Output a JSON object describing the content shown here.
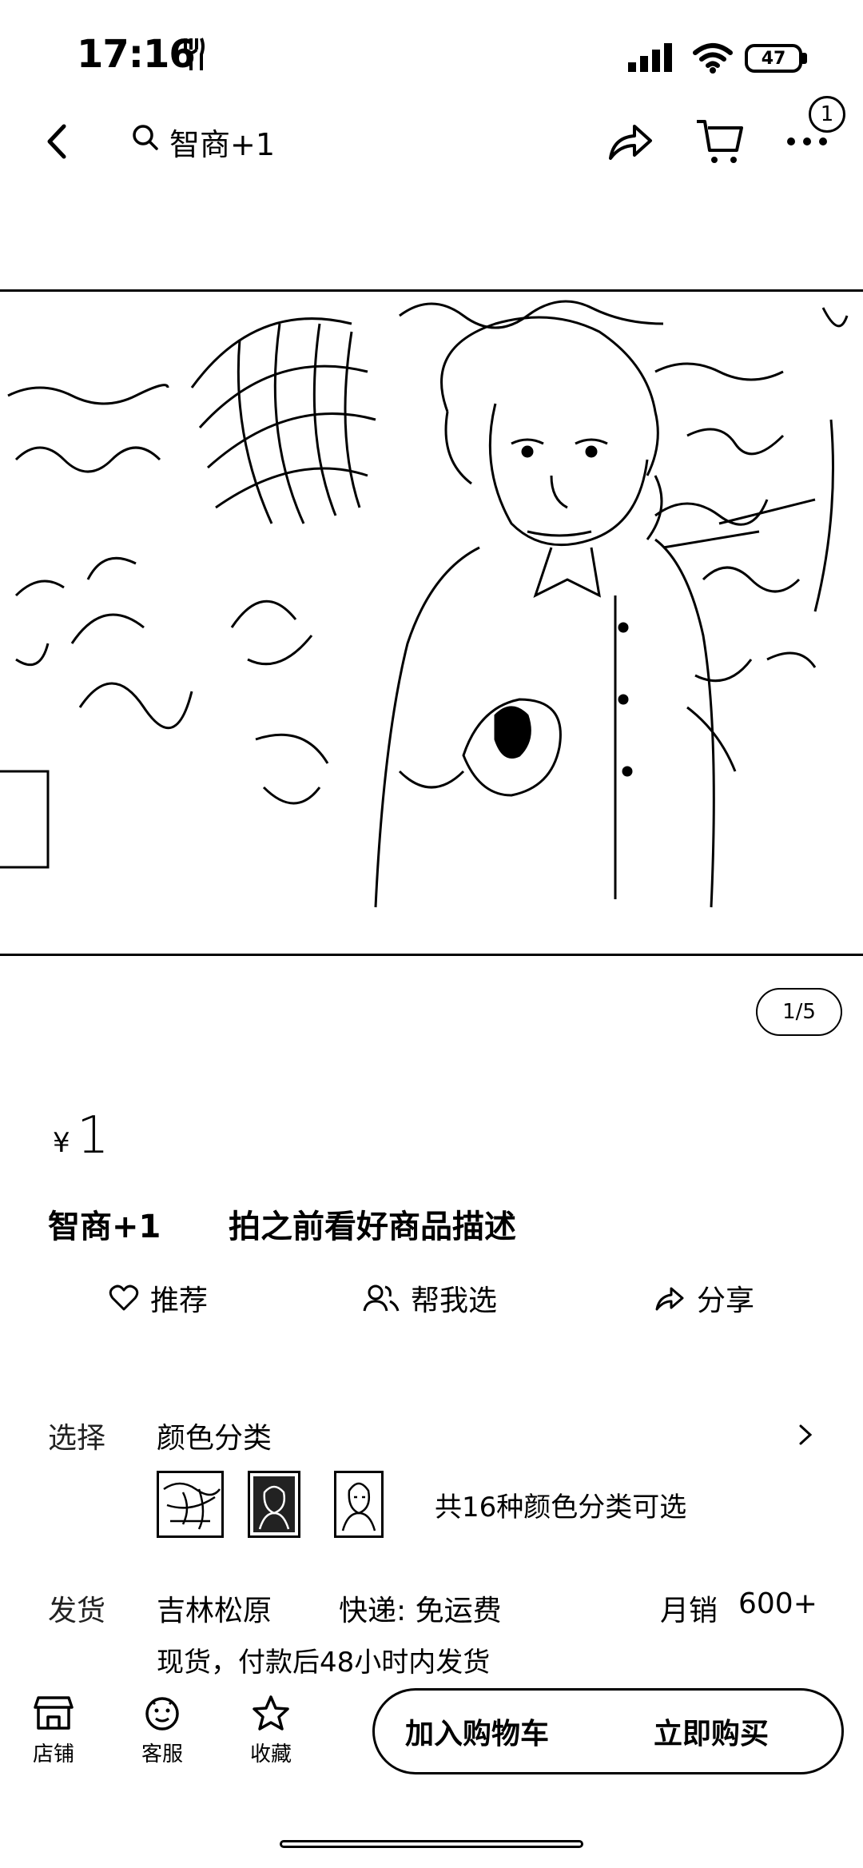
{
  "status_bar": {
    "time": "17:16",
    "battery": "47"
  },
  "nav": {
    "search_text": "智商+1",
    "cart_badge": "1"
  },
  "hero": {
    "counter": "1/5"
  },
  "product": {
    "currency": "¥",
    "price": "1",
    "title_main": "智商+1",
    "title_note": "拍之前看好商品描述"
  },
  "actions": {
    "recommend": "推荐",
    "help_choose": "帮我选",
    "share": "分享"
  },
  "options": {
    "label": "选择",
    "category": "颜色分类",
    "summary": "共16种颜色分类可选"
  },
  "shipping": {
    "label": "发货",
    "origin": "吉林松原",
    "express": "快递: 免运费",
    "monthly_sales_label": "月销",
    "monthly_sales_value": "600+",
    "note": "现货，付款后48小时内发货"
  },
  "bottom_bar": {
    "store": "店铺",
    "service": "客服",
    "favorite": "收藏",
    "add_to_cart": "加入购物车",
    "buy_now": "立即购买"
  }
}
